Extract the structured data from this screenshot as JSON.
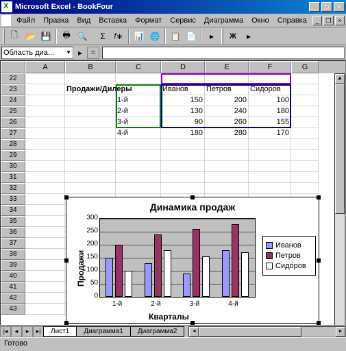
{
  "app": {
    "title": "Microsoft Excel - BookFour"
  },
  "menu": {
    "file": "Файл",
    "edit": "Правка",
    "view": "Вид",
    "insert": "Вставка",
    "format": "Формат",
    "tools": "Сервис",
    "chart": "Диаграмма",
    "window": "Окно",
    "help": "Справка"
  },
  "name_box": "Область диа...",
  "columns": [
    "A",
    "B",
    "C",
    "D",
    "E",
    "F",
    "G"
  ],
  "rows_start": 22,
  "rows_end": 43,
  "table": {
    "header_label": "Продажи/Дилеры",
    "dealers": [
      "Иванов",
      "Петров",
      "Сидоров"
    ],
    "periods": [
      "1-й",
      "2-й",
      "3-й",
      "4-й"
    ],
    "values": [
      [
        150,
        200,
        100
      ],
      [
        130,
        240,
        180
      ],
      [
        90,
        260,
        155
      ],
      [
        180,
        280,
        170
      ]
    ]
  },
  "chart_data": {
    "type": "bar",
    "title": "Динамика продаж",
    "xlabel": "Кварталы",
    "ylabel": "Продажи",
    "categories": [
      "1-й",
      "2-й",
      "3-й",
      "4-й"
    ],
    "series": [
      {
        "name": "Иванов",
        "values": [
          150,
          130,
          90,
          180
        ],
        "color": "#9999ff"
      },
      {
        "name": "Петров",
        "values": [
          200,
          240,
          260,
          280
        ],
        "color": "#993366"
      },
      {
        "name": "Сидоров",
        "values": [
          100,
          180,
          155,
          170
        ],
        "color": "#ffffff"
      }
    ],
    "ylim": [
      0,
      300
    ],
    "yticks": [
      0,
      50,
      100,
      150,
      200,
      250,
      300
    ]
  },
  "sheet_tabs": [
    "Лист1",
    "Диаграмма1",
    "Диаграмма2"
  ],
  "active_tab": 0,
  "status": "Готово"
}
